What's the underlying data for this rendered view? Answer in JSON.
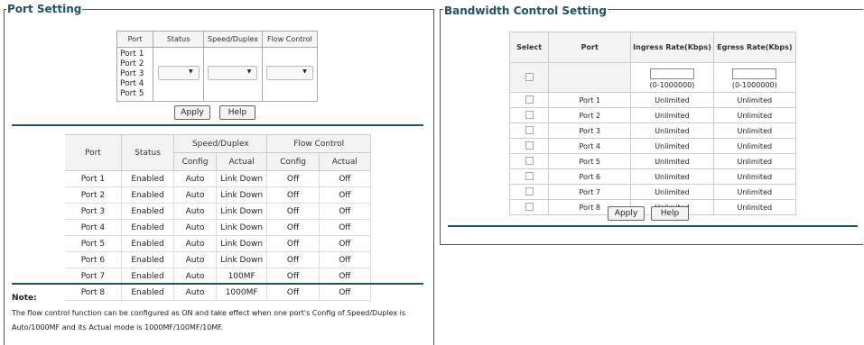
{
  "port_setting": {
    "title": "Port Setting",
    "columns": [
      "Port",
      "Status",
      "Speed/Duplex",
      "Flow Control"
    ],
    "ports": [
      "Port 1",
      "Port 2",
      "Port 3",
      "Port 4",
      "Port 5"
    ],
    "apply_label": "Apply",
    "help_label": "Help"
  },
  "status_table": {
    "headers": {
      "port": "Port",
      "status": "Status",
      "speed": "Speed/Duplex",
      "flow": "Flow Control",
      "config": "Config",
      "actual": "Actual"
    },
    "rows": [
      [
        "Port 1",
        "Enabled",
        "Auto",
        "Link Down",
        "Off",
        "Off"
      ],
      [
        "Port 2",
        "Enabled",
        "Auto",
        "Link Down",
        "Off",
        "Off"
      ],
      [
        "Port 3",
        "Enabled",
        "Auto",
        "Link Down",
        "Off",
        "Off"
      ],
      [
        "Port 4",
        "Enabled",
        "Auto",
        "Link Down",
        "Off",
        "Off"
      ],
      [
        "Port 5",
        "Enabled",
        "Auto",
        "Link Down",
        "Off",
        "Off"
      ],
      [
        "Port 6",
        "Enabled",
        "Auto",
        "Link Down",
        "Off",
        "Off"
      ],
      [
        "Port 7",
        "Enabled",
        "Auto",
        "100MF",
        "Off",
        "Off"
      ],
      [
        "Port 8",
        "Enabled",
        "Auto",
        "1000MF",
        "Off",
        "Off"
      ]
    ]
  },
  "note": {
    "title": "Note:",
    "text": "The flow control function can be configured as ON and take effect when one port's Config of Speed/Duplex is Auto/1000MF and its Actual mode is 1000MF/100MF/10MF."
  },
  "bandwidth": {
    "title": "Bandwidth Control Setting",
    "headers": {
      "select": "Select",
      "port": "Port",
      "ingress": "Ingress Rate(Kbps)",
      "egress": "Egress Rate(Kbps)"
    },
    "range_hint": "(0-1000000)",
    "rows": [
      [
        "Port 1",
        "Unlimited",
        "Unlimited"
      ],
      [
        "Port 2",
        "Unlimited",
        "Unlimited"
      ],
      [
        "Port 3",
        "Unlimited",
        "Unlimited"
      ],
      [
        "Port 4",
        "Unlimited",
        "Unlimited"
      ],
      [
        "Port 5",
        "Unlimited",
        "Unlimited"
      ],
      [
        "Port 6",
        "Unlimited",
        "Unlimited"
      ],
      [
        "Port 7",
        "Unlimited",
        "Unlimited"
      ],
      [
        "Port 8",
        "Unlimited",
        "Unlimited"
      ]
    ],
    "apply_label": "Apply",
    "help_label": "Help"
  }
}
